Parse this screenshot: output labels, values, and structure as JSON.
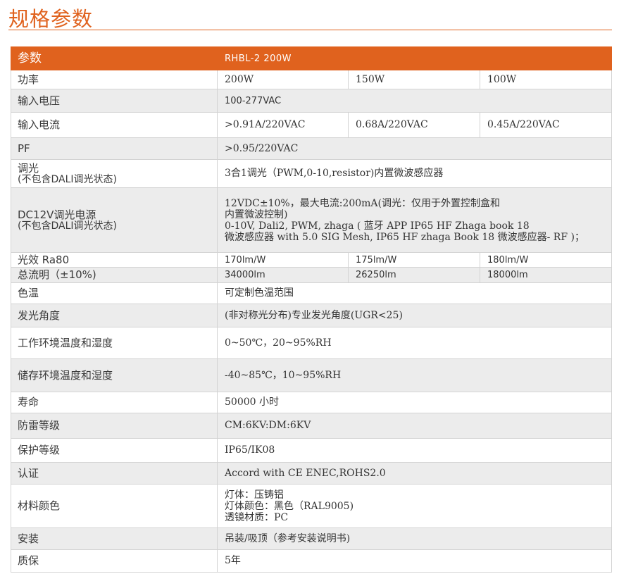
{
  "page": {
    "title": "规格参数"
  },
  "table": {
    "header": {
      "label": "参数",
      "model": "RHBL-2 200W"
    },
    "power": {
      "label": "功率",
      "values": [
        "200W",
        "150W",
        "100W"
      ]
    },
    "input_voltage": {
      "label": "输入电压",
      "value": "100-277VAC"
    },
    "input_current": {
      "label": "输入电流",
      "values": [
        ">0.91A/220VAC",
        "0.68A/220VAC",
        "0.45A/220VAC"
      ]
    },
    "pf": {
      "label": "PF",
      "value": ">0.95/220VAC"
    },
    "dimming": {
      "label": "调光",
      "sublabel": "(不包含DALI调光状态)",
      "value": "3合1调光（PWM,0-10,resistor)内置微波感应器"
    },
    "dc12v": {
      "label": "DC12V调光电源",
      "sublabel": "(不包含DALI调光状态)",
      "lines": [
        "12VDC±10%，最大电流:200mA(调光：仅用于外置控制盒和",
        "内置微波控制)",
        "0-10V, Dali2, PWM, zhaga ( 蓝牙 APP IP65 HF Zhaga book 18",
        "微波感应器 with 5.0 SIG Mesh, IP65 HF zhaga Book 18 微波感应器- RF )；"
      ]
    },
    "efficacy": {
      "label": "光效 Ra80",
      "values": [
        "170lm/W",
        "175lm/W",
        "180lm/W"
      ]
    },
    "flux": {
      "label": "总流明（±10%)",
      "values": [
        "34000lm",
        "26250lm",
        "18000lm"
      ]
    },
    "cct": {
      "label": "色温",
      "value": "可定制色温范围"
    },
    "beam": {
      "label": "发光角度",
      "value": "(非对称光分布)专业发光角度(UGR<25)"
    },
    "work_env": {
      "label": "工作环境温度和湿度",
      "value": "0~50℃，20~95%RH"
    },
    "storage_env": {
      "label": "储存环境温度和湿度",
      "value": "-40~85℃，10~95%RH"
    },
    "life": {
      "label": "寿命",
      "value": "50000 小时"
    },
    "surge": {
      "label": "防雷等级",
      "value": "CM:6KV:DM:6KV"
    },
    "protection": {
      "label": "保护等级",
      "value": "IP65/IK08"
    },
    "certification": {
      "label": "认证",
      "value": "Accord with CE ENEC,ROHS2.0"
    },
    "material": {
      "label": "材料颜色",
      "lines": [
        "灯体：压铸铝",
        "灯体颜色：黑色（RAL9005)",
        "透镜材质：PC"
      ]
    },
    "install": {
      "label": "安装",
      "value": "吊装/吸顶（参考安装说明书)"
    },
    "warranty": {
      "label": "质保",
      "value": "5年"
    }
  },
  "colors": {
    "accent": "#e0621e",
    "row_shade": "#ececec",
    "border": "#d3d3d3"
  }
}
